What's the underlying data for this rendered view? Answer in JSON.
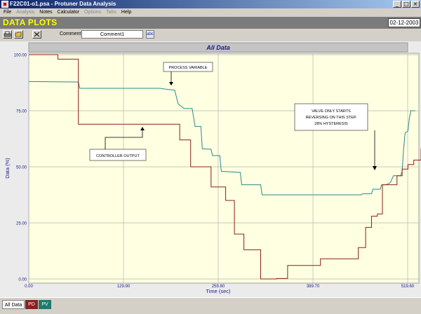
{
  "window": {
    "title": "F22C01-o1.psa - Protuner Data  Analysis"
  },
  "menu": {
    "items": [
      {
        "label": "File",
        "enabled": true
      },
      {
        "label": "Analysis",
        "enabled": false
      },
      {
        "label": "Notes",
        "enabled": true
      },
      {
        "label": "Calculator",
        "enabled": true
      },
      {
        "label": "Options",
        "enabled": false
      },
      {
        "label": "Tabs",
        "enabled": false
      },
      {
        "label": "Help",
        "enabled": true
      }
    ]
  },
  "header": {
    "title": "DATA PLOTS",
    "date": "02-12-2003"
  },
  "toolbar": {
    "comment_label": "Comment",
    "comment_value": "Comment1",
    "spell_icon_text": "abc"
  },
  "chart_data": {
    "type": "line",
    "title": "All Data",
    "xlabel": "Time (sec)",
    "ylabel": "Data (%)",
    "xlim": [
      0,
      519.6
    ],
    "ylim": [
      0,
      100
    ],
    "xticks": [
      "0.00",
      "129.90",
      "259.80",
      "389.70",
      "519.60"
    ],
    "yticks": [
      "0.00",
      "25.00",
      "50.00",
      "75.00",
      "100.00"
    ],
    "grid": true,
    "series": [
      {
        "name": "PV",
        "color": "#2a8a8a",
        "points": [
          [
            0,
            88
          ],
          [
            68,
            87.8
          ],
          [
            70,
            85
          ],
          [
            180,
            85
          ],
          [
            188,
            84.6
          ],
          [
            200,
            84.2
          ],
          [
            205,
            78
          ],
          [
            213,
            76
          ],
          [
            224,
            76
          ],
          [
            228,
            68
          ],
          [
            236,
            68
          ],
          [
            238,
            58
          ],
          [
            250,
            57.8
          ],
          [
            252,
            55
          ],
          [
            262,
            55
          ],
          [
            264,
            48
          ],
          [
            290,
            47.5
          ],
          [
            292,
            42
          ],
          [
            318,
            42
          ],
          [
            320,
            37.5
          ],
          [
            456,
            37.5
          ],
          [
            458,
            38
          ],
          [
            470,
            38
          ],
          [
            472,
            40
          ],
          [
            482,
            40
          ],
          [
            484,
            42
          ],
          [
            490,
            42
          ],
          [
            496,
            43
          ],
          [
            500,
            46
          ],
          [
            510,
            46
          ],
          [
            512,
            48
          ],
          [
            514,
            58
          ],
          [
            516,
            65
          ],
          [
            520,
            66
          ],
          [
            522,
            72
          ],
          [
            524,
            75
          ],
          [
            530,
            75
          ]
        ]
      },
      {
        "name": "PD",
        "color": "#8b1f1f",
        "points": [
          [
            0,
            100
          ],
          [
            40,
            100
          ],
          [
            40,
            98
          ],
          [
            68,
            98
          ],
          [
            68,
            69
          ],
          [
            207,
            69
          ],
          [
            207,
            62
          ],
          [
            222,
            62
          ],
          [
            222,
            50
          ],
          [
            250,
            50
          ],
          [
            250,
            41
          ],
          [
            270,
            41
          ],
          [
            270,
            35
          ],
          [
            282,
            35
          ],
          [
            282,
            20
          ],
          [
            295,
            20
          ],
          [
            295,
            13
          ],
          [
            318,
            13
          ],
          [
            318,
            0
          ],
          [
            340,
            0
          ],
          [
            340,
            0.2
          ],
          [
            355,
            0.2
          ],
          [
            355,
            6
          ],
          [
            400,
            6
          ],
          [
            400,
            9
          ],
          [
            452,
            9
          ],
          [
            452,
            14
          ],
          [
            462,
            14
          ],
          [
            462,
            23
          ],
          [
            470,
            23
          ],
          [
            470,
            28
          ],
          [
            478,
            28
          ],
          [
            478,
            29
          ],
          [
            485,
            29
          ],
          [
            485,
            42
          ],
          [
            505,
            42
          ],
          [
            505,
            46
          ],
          [
            512,
            46
          ],
          [
            512,
            49
          ],
          [
            520,
            49
          ],
          [
            520,
            51
          ],
          [
            528,
            51
          ],
          [
            528,
            53
          ],
          [
            538,
            53
          ],
          [
            538,
            58
          ],
          [
            548,
            58
          ],
          [
            548,
            60
          ],
          [
            556,
            60
          ]
        ]
      }
    ],
    "annotations": [
      {
        "text": "PROCESS VARIABLE"
      },
      {
        "text": "CONTROLLER OUTPUT"
      },
      {
        "lines": [
          "VALVE ONLY STARTS",
          "REVERSING ON THIS STEP.",
          "28% HYSTERESIS"
        ]
      }
    ]
  },
  "tabs": [
    {
      "label": "All Data",
      "active": true
    },
    {
      "label": "PD",
      "color": "#8b1f1f"
    },
    {
      "label": "PV",
      "color": "#1f7a6a"
    }
  ]
}
